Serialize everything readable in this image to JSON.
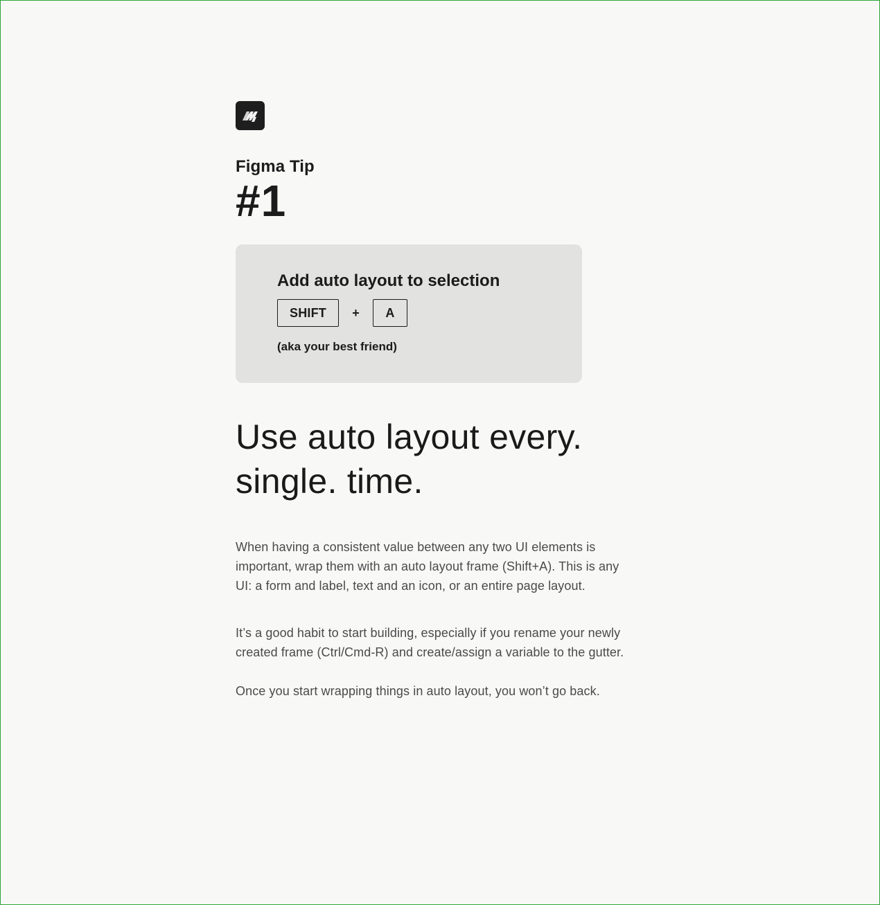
{
  "brand": {
    "logo_icon": "brand-logo-icon",
    "logo_bg": "#1e1e1e",
    "logo_fg": "#f2f2f2"
  },
  "tip": {
    "eyebrow": "Figma Tip",
    "number": "#1"
  },
  "shortcut": {
    "title": "Add auto layout to selection",
    "key1": "SHIFT",
    "plus": "+",
    "key2": "A",
    "note": "(aka your best friend)"
  },
  "headline": {
    "line1": "Use auto layout every.",
    "line2": "single. time."
  },
  "paragraphs": [
    "When having a consistent value between any two UI elements is important, wrap them with an auto layout frame (Shift+A). This is any UI: a form and label, text and an icon, or an entire page layout.",
    "It’s a good habit to start building, especially if you rename your newly created frame (Ctrl/Cmd-R) and create/assign a variable to the gutter.",
    "Once you start wrapping things in auto layout, you won’t go back."
  ],
  "colors": {
    "background": "#f8f8f7",
    "card": "#e2e2e0",
    "text_primary": "#1b1b1b",
    "text_secondary": "#4a4a4a",
    "frame_border": "#2ea53a"
  }
}
